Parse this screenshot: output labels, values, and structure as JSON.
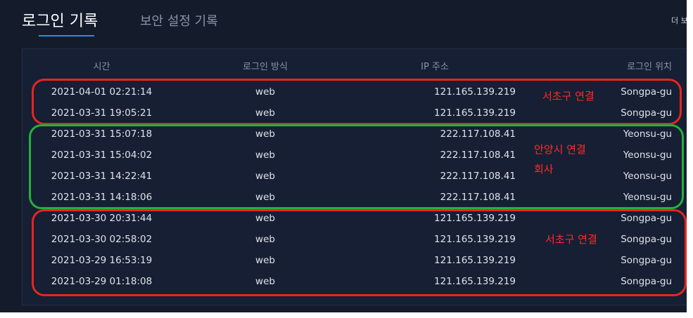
{
  "tabs": {
    "active_label": "로그인 기록",
    "inactive_label": "보안 설정 기록",
    "more_label": "더 보"
  },
  "table": {
    "headers": {
      "time": "시간",
      "method": "로그인 방식",
      "ip": "IP 주소",
      "location": "로그인 위치"
    },
    "rows": [
      {
        "time": "2021-04-01 02:21:14",
        "method": "web",
        "ip": "121.165.139.219",
        "location": "Songpa-gu"
      },
      {
        "time": "2021-03-31 19:05:21",
        "method": "web",
        "ip": "121.165.139.219",
        "location": "Songpa-gu"
      },
      {
        "time": "2021-03-31 15:07:18",
        "method": "web",
        "ip": "222.117.108.41",
        "location": "Yeonsu-gu"
      },
      {
        "time": "2021-03-31 15:04:02",
        "method": "web",
        "ip": "222.117.108.41",
        "location": "Yeonsu-gu"
      },
      {
        "time": "2021-03-31 14:22:41",
        "method": "web",
        "ip": "222.117.108.41",
        "location": "Yeonsu-gu"
      },
      {
        "time": "2021-03-31 14:18:06",
        "method": "web",
        "ip": "222.117.108.41",
        "location": "Yeonsu-gu"
      },
      {
        "time": "2021-03-30 20:31:44",
        "method": "web",
        "ip": "121.165.139.219",
        "location": "Songpa-gu"
      },
      {
        "time": "2021-03-30 02:58:02",
        "method": "web",
        "ip": "121.165.139.219",
        "location": "Songpa-gu"
      },
      {
        "time": "2021-03-29 16:53:19",
        "method": "web",
        "ip": "121.165.139.219",
        "location": "Songpa-gu"
      },
      {
        "time": "2021-03-29 01:18:08",
        "method": "web",
        "ip": "121.165.139.219",
        "location": "Songpa-gu"
      }
    ]
  },
  "annotations": {
    "group1": "서초구 연결",
    "group2_line1": "안양시 연결",
    "group2_line2": "회사",
    "group3": "서초구 연결"
  },
  "colors": {
    "background": "#141b2b",
    "accent_tab": "#2d8cf0",
    "annotation_red": "#e8251f",
    "annotation_green": "#22b23c"
  }
}
